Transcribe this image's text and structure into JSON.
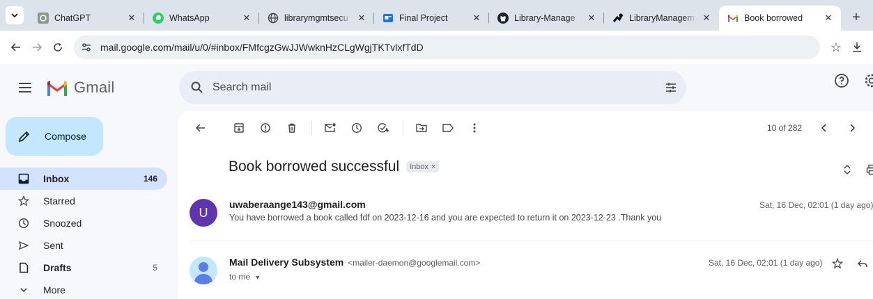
{
  "browser": {
    "tabs": [
      {
        "title": "ChatGPT",
        "icon": "chatgpt-icon"
      },
      {
        "title": "WhatsApp",
        "icon": "whatsapp-icon"
      },
      {
        "title": "librarymgmtsecu",
        "icon": "globe-icon"
      },
      {
        "title": "Final Project",
        "icon": "slides-icon"
      },
      {
        "title": "Library-Manage",
        "icon": "github-icon"
      },
      {
        "title": "LibraryManagem",
        "icon": "app-icon"
      },
      {
        "title": "Book borrowed",
        "icon": "gmail-icon",
        "active": true
      }
    ],
    "url": "mail.google.com/mail/u/0/#inbox/FMfcgzGwJJWwknHzCLgWgjTKTvlxfTdD"
  },
  "gmail": {
    "logo_text": "Gmail",
    "search_placeholder": "Search mail",
    "compose_label": "Compose",
    "nav": [
      {
        "label": "Inbox",
        "count": "146",
        "icon": "inbox-icon",
        "active": true
      },
      {
        "label": "Starred",
        "count": "",
        "icon": "star-icon"
      },
      {
        "label": "Snoozed",
        "count": "",
        "icon": "clock-icon"
      },
      {
        "label": "Sent",
        "count": "",
        "icon": "send-icon"
      },
      {
        "label": "Drafts",
        "count": "5",
        "icon": "draft-icon",
        "bold": true
      },
      {
        "label": "More",
        "count": "",
        "icon": "chevron-down-icon"
      }
    ],
    "pager": "10 of 282",
    "thread": {
      "subject": "Book borrowed successful",
      "label": "Inbox",
      "messages": [
        {
          "avatar_letter": "U",
          "avatar_color": "#5e35b1",
          "sender": "uwaberaange143@gmail.com",
          "sender_email": "",
          "body": "You have borrowed a book called fdf on 2023-12-16 and you are expected to return it on 2023-12-23 .Thank you",
          "date": "Sat, 16 Dec, 02:01 (1 day ago)"
        },
        {
          "avatar_letter": "",
          "avatar_color": "#c2e7ff",
          "sender": "Mail Delivery Subsystem",
          "sender_email": "<mailer-daemon@googlemail.com>",
          "body": "to me",
          "date": "Sat, 16 Dec, 02:01 (1 day ago)"
        }
      ]
    }
  }
}
